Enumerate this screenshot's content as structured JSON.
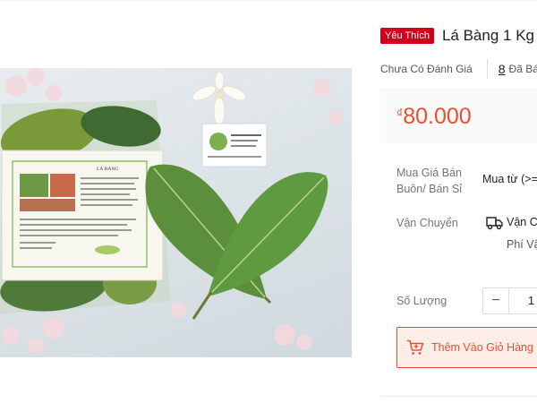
{
  "product": {
    "badge": "Yêu Thích",
    "title": "Lá Bàng 1 Kg",
    "rating_text": "Chưa Có Đánh Giá",
    "sold_count": "8",
    "sold_label": "Đã Bá",
    "price_currency": "₫",
    "price": "80.000"
  },
  "details": {
    "wholesale_label_1": "Mua Giá Bán",
    "wholesale_label_2": "Buôn/ Bán Sỉ",
    "wholesale_value": "Mua từ (>=",
    "shipping_label": "Vận Chuyển",
    "shipping_value": "Vận C",
    "shipping_fee": "Phí Vậ",
    "quantity_label": "Số Lượng",
    "quantity_minus": "−",
    "quantity_value": "1"
  },
  "actions": {
    "add_to_cart": "Thêm Vào Giỏ Hàng"
  },
  "image": {
    "package_heading": "LÁ BÀNG"
  },
  "colors": {
    "accent": "#ee4d2d",
    "badge": "#d0011b",
    "price_bg": "#fafafa"
  }
}
